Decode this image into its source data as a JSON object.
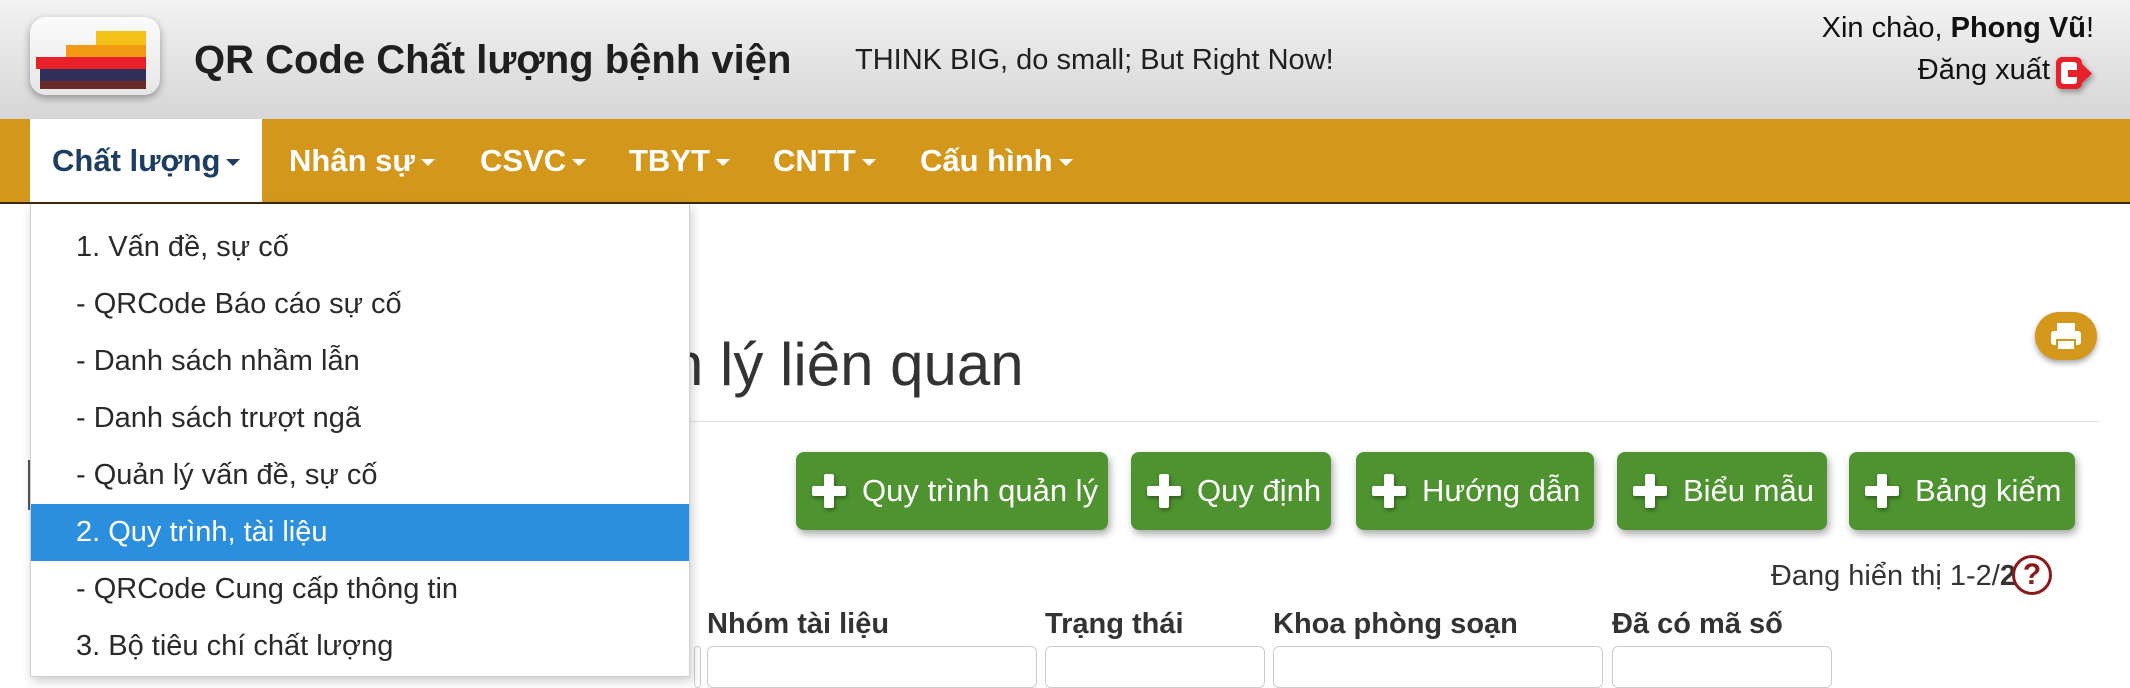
{
  "header": {
    "app_title": "QR Code Chất lượng bệnh viện",
    "slogan": "THINK BIG, do small; But Right Now!",
    "greeting_prefix": "Xin chào, ",
    "user_name": "Phong Vũ",
    "greeting_suffix": "!",
    "logout_label": "Đăng xuất"
  },
  "navbar": {
    "items": [
      {
        "label": "Chất lượng",
        "active": true
      },
      {
        "label": "Nhân sự"
      },
      {
        "label": "CSVC"
      },
      {
        "label": "TBYT"
      },
      {
        "label": "CNTT"
      },
      {
        "label": "Cấu hình"
      }
    ]
  },
  "dropdown": {
    "items": [
      {
        "label": "1. Vấn đề, sự cố"
      },
      {
        "label": "- QRCode Báo cáo sự cố"
      },
      {
        "label": "- Danh sách nhầm lẫn"
      },
      {
        "label": "- Danh sách trượt ngã"
      },
      {
        "label": "- Quản lý vấn đề, sự cố"
      },
      {
        "label": "2. Quy trình, tài liệu",
        "selected": true
      },
      {
        "label": "- QRCode Cung cấp thông tin"
      },
      {
        "label": "3. Bộ tiêu chí chất lượng"
      }
    ]
  },
  "main": {
    "page_title_visible": "n lý liên quan",
    "buttons": [
      {
        "label": "Quy trình quản lý"
      },
      {
        "label": "Quy định"
      },
      {
        "label": "Hướng dẫn"
      },
      {
        "label": "Biểu mẫu"
      },
      {
        "label": "Bảng kiểm"
      }
    ],
    "showing_prefix": "Đang hiển thị 1-2/",
    "showing_total": "2",
    "help_glyph": "?",
    "columns": [
      {
        "label": "Nhóm tài liệu"
      },
      {
        "label": "Trạng thái"
      },
      {
        "label": "Khoa phòng soạn"
      },
      {
        "label": "Đã có mã số"
      }
    ]
  },
  "colors": {
    "header_bg": "#e4e4e4",
    "navbar_bg": "#d3971c",
    "active_nav_text": "#1d3d62",
    "dropdown_selected": "#2b8fde",
    "button_green": "#4e9330",
    "help_icon": "#8b1a1a"
  },
  "icons": {
    "logo": "hospital-logo",
    "logout": "logout-icon",
    "print": "print-icon",
    "plus": "plus-icon",
    "help": "help-icon"
  }
}
